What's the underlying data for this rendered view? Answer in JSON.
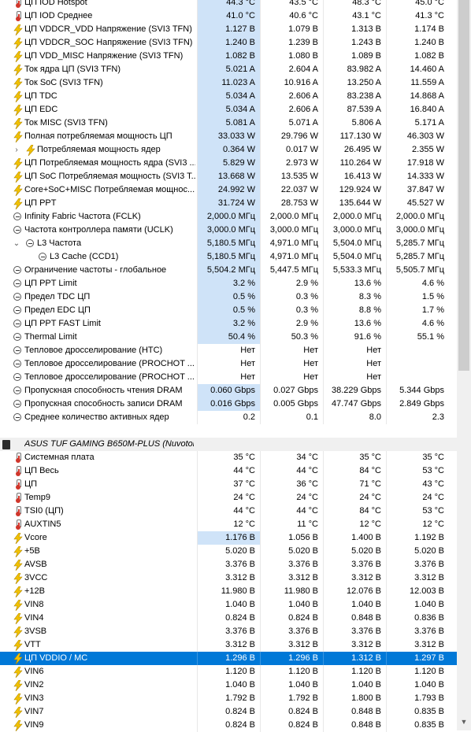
{
  "rows": [
    {
      "label": "ЦП IOD Hotspot",
      "icon": "thermometer-icon",
      "v": [
        "44.3 °C",
        "43.5 °C",
        "48.3 °C",
        "45.0 °C"
      ]
    },
    {
      "label": "ЦП IOD Среднее",
      "icon": "thermometer-icon",
      "v": [
        "41.0 °C",
        "40.6 °C",
        "43.1 °C",
        "41.3 °C"
      ]
    },
    {
      "label": "ЦП VDDCR_VDD Напряжение (SVI3 TFN)",
      "icon": "bolt-icon",
      "v": [
        "1.127 В",
        "1.079 В",
        "1.313 В",
        "1.174 В"
      ]
    },
    {
      "label": "ЦП VDDCR_SOC Напряжение (SVI3 TFN)",
      "icon": "bolt-icon",
      "v": [
        "1.240 В",
        "1.239 В",
        "1.243 В",
        "1.240 В"
      ]
    },
    {
      "label": "ЦП VDD_MISC Напряжение (SVI3 TFN)",
      "icon": "bolt-icon",
      "v": [
        "1.082 В",
        "1.080 В",
        "1.089 В",
        "1.082 В"
      ]
    },
    {
      "label": "Ток ядра ЦП (SVI3 TFN)",
      "icon": "bolt-icon",
      "v": [
        "5.021 A",
        "2.604 A",
        "83.982 A",
        "14.460 A"
      ]
    },
    {
      "label": "Ток SoC (SVI3 TFN)",
      "icon": "bolt-icon",
      "v": [
        "11.023 A",
        "10.916 A",
        "13.250 A",
        "11.559 A"
      ]
    },
    {
      "label": "ЦП TDC",
      "icon": "bolt-icon",
      "v": [
        "5.034 A",
        "2.606 A",
        "83.238 A",
        "14.868 A"
      ]
    },
    {
      "label": "ЦП EDC",
      "icon": "bolt-icon",
      "v": [
        "5.034 A",
        "2.606 A",
        "87.539 A",
        "16.840 A"
      ]
    },
    {
      "label": "Ток MISC (SVI3 TFN)",
      "icon": "bolt-icon",
      "v": [
        "5.081 A",
        "5.071 A",
        "5.806 A",
        "5.171 A"
      ]
    },
    {
      "label": "Полная потребляемая мощность ЦП",
      "icon": "bolt-icon",
      "v": [
        "33.033 W",
        "29.796 W",
        "117.130 W",
        "46.303 W"
      ]
    },
    {
      "label": "Потребляемая мощность ядер",
      "icon": "bolt-icon",
      "expander": "›",
      "indent": 1,
      "v": [
        "0.364 W",
        "0.017 W",
        "26.495 W",
        "2.355 W"
      ]
    },
    {
      "label": "ЦП Потребляемая мощность ядра (SVI3 ...",
      "icon": "bolt-icon",
      "v": [
        "5.829 W",
        "2.973 W",
        "110.264 W",
        "17.918 W"
      ]
    },
    {
      "label": "ЦП SoC Потребляемая мощность (SVI3 T...",
      "icon": "bolt-icon",
      "v": [
        "13.668 W",
        "13.535 W",
        "16.413 W",
        "14.333 W"
      ]
    },
    {
      "label": "Core+SoC+MISC Потребляемая мощнос...",
      "icon": "bolt-icon",
      "v": [
        "24.992 W",
        "22.037 W",
        "129.924 W",
        "37.847 W"
      ]
    },
    {
      "label": "ЦП PPT",
      "icon": "bolt-icon",
      "v": [
        "31.724 W",
        "28.753 W",
        "135.644 W",
        "45.527 W"
      ]
    },
    {
      "label": "Infinity Fabric Частота (FCLK)",
      "icon": "clock-icon",
      "v": [
        "2,000.0 МГц",
        "2,000.0 МГц",
        "2,000.0 МГц",
        "2,000.0 МГц"
      ]
    },
    {
      "label": "Частота контроллера памяти (UCLK)",
      "icon": "clock-icon",
      "v": [
        "3,000.0 МГц",
        "3,000.0 МГц",
        "3,000.0 МГц",
        "3,000.0 МГц"
      ]
    },
    {
      "label": "L3 Частота",
      "icon": "clock-icon",
      "expander": "⌄",
      "indent": 1,
      "v": [
        "5,180.5 МГц",
        "4,971.0 МГц",
        "5,504.0 МГц",
        "5,285.7 МГц"
      ]
    },
    {
      "label": "L3 Cache (CCD1)",
      "icon": "clock-icon",
      "indent": 2,
      "v": [
        "5,180.5 МГц",
        "4,971.0 МГц",
        "5,504.0 МГц",
        "5,285.7 МГц"
      ]
    },
    {
      "label": "Ограничение частоты - глобальное",
      "icon": "clock-icon",
      "v": [
        "5,504.2 МГц",
        "5,447.5 МГц",
        "5,533.3 МГц",
        "5,505.7 МГц"
      ]
    },
    {
      "label": "ЦП PPT Limit",
      "icon": "clock-icon",
      "v": [
        "3.2 %",
        "2.9 %",
        "13.6 %",
        "4.6 %"
      ]
    },
    {
      "label": "Предел TDC ЦП",
      "icon": "clock-icon",
      "v": [
        "0.5 %",
        "0.3 %",
        "8.3 %",
        "1.5 %"
      ]
    },
    {
      "label": "Предел EDC ЦП",
      "icon": "clock-icon",
      "v": [
        "0.5 %",
        "0.3 %",
        "8.8 %",
        "1.7 %"
      ]
    },
    {
      "label": "ЦП PPT FAST Limit",
      "icon": "clock-icon",
      "v": [
        "3.2 %",
        "2.9 %",
        "13.6 %",
        "4.6 %"
      ]
    },
    {
      "label": "Thermal Limit",
      "icon": "clock-icon",
      "v": [
        "50.4 %",
        "50.3 %",
        "91.6 %",
        "55.1 %"
      ]
    },
    {
      "label": "Тепловое дросселирование (HTC)",
      "icon": "clock-icon",
      "v": [
        "Нет",
        "Нет",
        "Нет",
        ""
      ]
    },
    {
      "label": "Тепловое дросселирование (PROCHOT ...",
      "icon": "clock-icon",
      "v": [
        "Нет",
        "Нет",
        "Нет",
        ""
      ]
    },
    {
      "label": "Тепловое дросселирование (PROCHOT ...",
      "icon": "clock-icon",
      "v": [
        "Нет",
        "Нет",
        "Нет",
        ""
      ]
    },
    {
      "label": "Пропускная способность чтения DRAM",
      "icon": "clock-icon",
      "v": [
        "0.060 Gbps",
        "0.027 Gbps",
        "38.229 Gbps",
        "5.344 Gbps"
      ]
    },
    {
      "label": "Пропускная способность записи DRAM",
      "icon": "clock-icon",
      "v": [
        "0.016 Gbps",
        "0.005 Gbps",
        "47.747 Gbps",
        "2.849 Gbps"
      ]
    },
    {
      "label": "Среднее количество активных ядер",
      "icon": "clock-icon",
      "v": [
        "0.2",
        "0.1",
        "8.0",
        "2.3"
      ]
    },
    {
      "gap": true
    },
    {
      "header": true,
      "label": "ASUS TUF GAMING B650M-PLUS (Nuvoton...",
      "icon": "chip-icon"
    },
    {
      "label": "Системная плата",
      "icon": "thermometer-icon",
      "v": [
        "35 °C",
        "34 °C",
        "35 °C",
        "35 °C"
      ]
    },
    {
      "label": "ЦП Весь",
      "icon": "thermometer-icon",
      "v": [
        "44 °C",
        "44 °C",
        "84 °C",
        "53 °C"
      ]
    },
    {
      "label": "ЦП",
      "icon": "thermometer-icon",
      "v": [
        "37 °C",
        "36 °C",
        "71 °C",
        "43 °C"
      ]
    },
    {
      "label": "Temp9",
      "icon": "thermometer-icon",
      "v": [
        "24 °C",
        "24 °C",
        "24 °C",
        "24 °C"
      ]
    },
    {
      "label": "TSI0 (ЦП)",
      "icon": "thermometer-icon",
      "v": [
        "44 °C",
        "44 °C",
        "84 °C",
        "53 °C"
      ]
    },
    {
      "label": "AUXTIN5",
      "icon": "thermometer-icon",
      "v": [
        "12 °C",
        "11 °C",
        "12 °C",
        "12 °C"
      ]
    },
    {
      "label": "Vcore",
      "icon": "bolt-icon",
      "v": [
        "1.176 В",
        "1.056 В",
        "1.400 В",
        "1.192 В"
      ]
    },
    {
      "label": "+5В",
      "icon": "bolt-icon",
      "v": [
        "5.020 В",
        "5.020 В",
        "5.020 В",
        "5.020 В"
      ]
    },
    {
      "label": "AVSB",
      "icon": "bolt-icon",
      "v": [
        "3.376 В",
        "3.376 В",
        "3.376 В",
        "3.376 В"
      ]
    },
    {
      "label": "3VCC",
      "icon": "bolt-icon",
      "v": [
        "3.312 В",
        "3.312 В",
        "3.312 В",
        "3.312 В"
      ]
    },
    {
      "label": "+12В",
      "icon": "bolt-icon",
      "v": [
        "11.980 В",
        "11.980 В",
        "12.076 В",
        "12.003 В"
      ]
    },
    {
      "label": "VIN8",
      "icon": "bolt-icon",
      "v": [
        "1.040 В",
        "1.040 В",
        "1.040 В",
        "1.040 В"
      ]
    },
    {
      "label": "VIN4",
      "icon": "bolt-icon",
      "v": [
        "0.824 В",
        "0.824 В",
        "0.848 В",
        "0.836 В"
      ]
    },
    {
      "label": "3VSB",
      "icon": "bolt-icon",
      "v": [
        "3.376 В",
        "3.376 В",
        "3.376 В",
        "3.376 В"
      ]
    },
    {
      "label": "VTT",
      "icon": "bolt-icon",
      "v": [
        "3.312 В",
        "3.312 В",
        "3.312 В",
        "3.312 В"
      ]
    },
    {
      "label": "ЦП VDDIO / MC",
      "icon": "bolt-icon",
      "selected": true,
      "v": [
        "1.296 В",
        "1.296 В",
        "1.312 В",
        "1.297 В"
      ]
    },
    {
      "label": "VIN6",
      "icon": "bolt-icon",
      "v": [
        "1.120 В",
        "1.120 В",
        "1.120 В",
        "1.120 В"
      ]
    },
    {
      "label": "VIN2",
      "icon": "bolt-icon",
      "v": [
        "1.040 В",
        "1.040 В",
        "1.040 В",
        "1.040 В"
      ]
    },
    {
      "label": "VIN3",
      "icon": "bolt-icon",
      "v": [
        "1.792 В",
        "1.792 В",
        "1.800 В",
        "1.793 В"
      ]
    },
    {
      "label": "VIN7",
      "icon": "bolt-icon",
      "v": [
        "0.824 В",
        "0.824 В",
        "0.848 В",
        "0.835 В"
      ]
    },
    {
      "label": "VIN9",
      "icon": "bolt-icon",
      "v": [
        "0.824 В",
        "0.824 В",
        "0.848 В",
        "0.835 В"
      ]
    }
  ],
  "scrollbar": {
    "down_arrow": "▼"
  },
  "colors": {
    "selection": "#0078d7",
    "highlight": "#cfe3f8",
    "bolt": "#f2c200",
    "thermo_red": "#d0362b"
  }
}
